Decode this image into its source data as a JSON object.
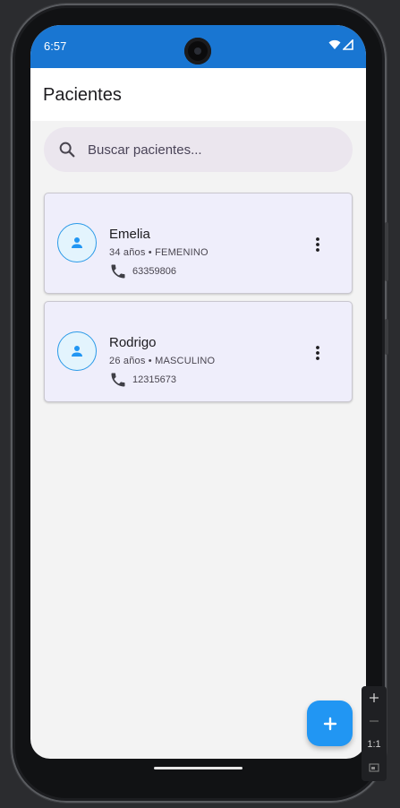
{
  "status_bar": {
    "time": "6:57"
  },
  "app_bar": {
    "title": "Pacientes"
  },
  "search": {
    "placeholder": "Buscar pacientes..."
  },
  "patients": [
    {
      "name": "Emelia",
      "details": "34 años • FEMENINO",
      "phone": "63359806"
    },
    {
      "name": "Rodrigo",
      "details": "26 años • MASCULINO",
      "phone": "12315673"
    }
  ],
  "emulator_zoom": {
    "ratio_label": "1:1"
  },
  "colors": {
    "status_bar": "#1976d2",
    "fab": "#2196f3",
    "avatar_accent": "#2a9ae8",
    "card_bg": "#efeefb"
  },
  "icons": {
    "search": "search-icon",
    "avatar": "person-icon",
    "phone": "phone-icon",
    "menu": "more-vert-icon",
    "fab": "add-icon"
  }
}
